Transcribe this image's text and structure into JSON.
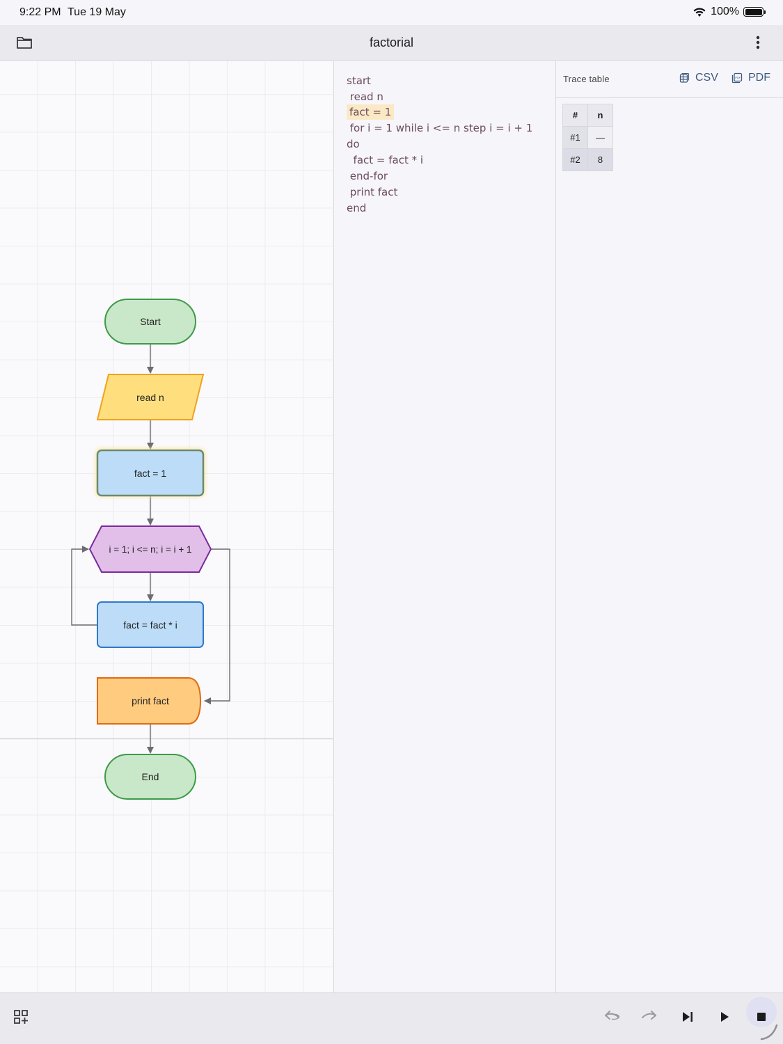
{
  "status_bar": {
    "time": "9:22 PM",
    "date": "Tue 19 May",
    "battery": "100%",
    "icons": [
      "wifi-icon",
      "battery-icon"
    ]
  },
  "toolbar": {
    "title": "factorial",
    "icons": [
      "folder-icon",
      "more-vertical-icon"
    ]
  },
  "flowchart": {
    "nodes": [
      {
        "id": "start",
        "shape": "terminal",
        "label": "Start",
        "color": "#c9e7c9"
      },
      {
        "id": "read",
        "shape": "parallelogram",
        "label": "read n",
        "color": "#ffde7e"
      },
      {
        "id": "assign1",
        "shape": "process",
        "label": "fact = 1",
        "color": "#bcdcf7",
        "highlighted": true
      },
      {
        "id": "loop",
        "shape": "hexagon",
        "label": "i = 1; i <= n; i = i + 1",
        "color": "#e2bfe8"
      },
      {
        "id": "assign2",
        "shape": "process",
        "label": "fact = fact * i",
        "color": "#bcdcf7"
      },
      {
        "id": "print",
        "shape": "display",
        "label": "print fact",
        "color": "#ffcb7f"
      },
      {
        "id": "end",
        "shape": "terminal",
        "label": "End",
        "color": "#c9e7c9"
      }
    ]
  },
  "code": {
    "lines": [
      {
        "text": "start",
        "highlighted": false
      },
      {
        "text": " read n",
        "highlighted": false
      },
      {
        "text": "fact = 1",
        "highlighted": true
      },
      {
        "text": " for i = 1 while i <= n step i = i + 1",
        "highlighted": false
      },
      {
        "text": "do",
        "highlighted": false
      },
      {
        "text": "  fact = fact * i",
        "highlighted": false
      },
      {
        "text": " end-for",
        "highlighted": false
      },
      {
        "text": " print fact",
        "highlighted": false
      },
      {
        "text": "end",
        "highlighted": false
      }
    ]
  },
  "trace": {
    "title": "Trace table",
    "csv_label": "CSV",
    "pdf_label": "PDF",
    "columns": [
      "#",
      "n"
    ],
    "rows": [
      [
        "#1",
        "—"
      ],
      [
        "#2",
        "8"
      ]
    ]
  },
  "bottom_bar": {
    "icons": [
      "add-block-icon",
      "undo-icon",
      "redo-icon",
      "step-icon",
      "play-icon",
      "stop-icon"
    ]
  },
  "colors": {
    "accent": "#3d5a80",
    "code_text": "#6b4a5e",
    "highlight": "#fbe9c6"
  }
}
